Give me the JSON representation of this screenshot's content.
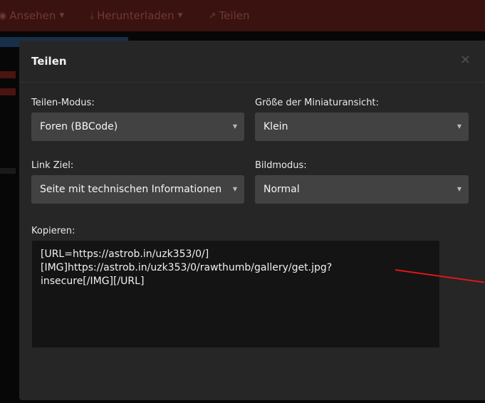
{
  "navbar": {
    "items": [
      {
        "label": "Ansehen",
        "icon": "eye-icon"
      },
      {
        "label": "Herunterladen",
        "icon": "download-icon"
      },
      {
        "label": "Teilen",
        "icon": "share-icon"
      }
    ]
  },
  "modal": {
    "title": "Teilen",
    "close_label": "×",
    "share_mode": {
      "label": "Teilen-Modus:",
      "value": "Foren (BBCode)"
    },
    "thumb_size": {
      "label": "Größe der Miniaturansicht:",
      "value": "Klein"
    },
    "link_target": {
      "label": "Link Ziel:",
      "value": "Seite mit technischen Informationen"
    },
    "image_mode": {
      "label": "Bildmodus:",
      "value": "Normal"
    },
    "copy": {
      "label": "Kopieren:",
      "value": "[URL=https://astrob.in/uzk353/0/]\n[IMG]https://astrob.in/uzk353/0/rawthumb/gallery/get.jpg?\ninsecure[/IMG][/URL]"
    }
  },
  "colors": {
    "annotation_arrow": "#e0161a",
    "modal_bg": "#262626",
    "select_bg": "#424242"
  }
}
